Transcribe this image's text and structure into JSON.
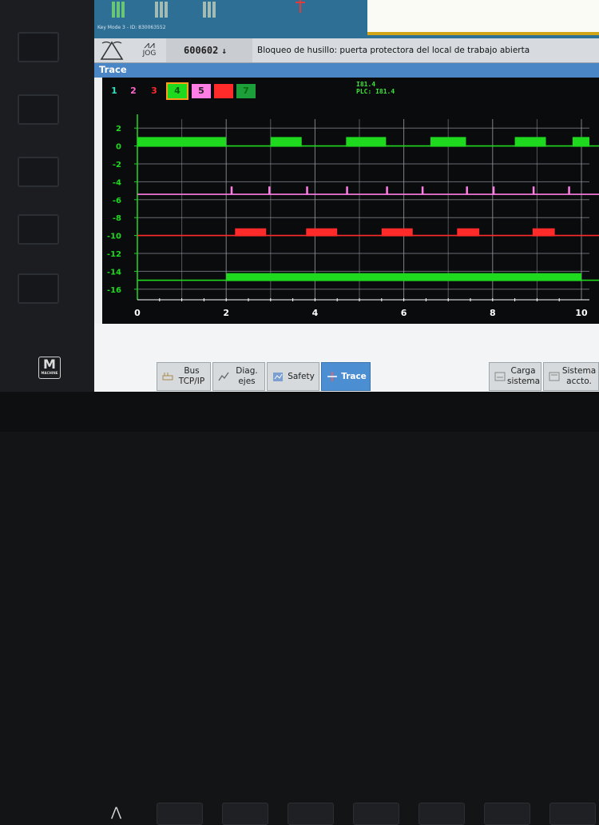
{
  "header": {
    "key_mode": "Key Mode 3 - ID: 830063552",
    "mode": "JOG",
    "alarm_number": "600602",
    "alarm_arrow": "↓",
    "alarm_message": "Bloqueo de husillo: puerta protectora del local de trabajo abierta"
  },
  "window": {
    "title": "Trace"
  },
  "legend": [
    {
      "label": "1",
      "color": "#33e0c0"
    },
    {
      "label": "2",
      "color": "#ff66cc"
    },
    {
      "label": "3",
      "color": "#ff2a2a"
    },
    {
      "label": "4",
      "color": "#1fd91f",
      "selected": true
    },
    {
      "label": "5",
      "color": "#ff7ee6"
    },
    {
      "label": "6",
      "color": "#ff2a2a"
    },
    {
      "label": "7",
      "color": "#1c9e3a"
    }
  ],
  "signal_label": {
    "line1": "I81.4",
    "line2": "PLC: I81.4"
  },
  "chart_data": {
    "type": "line",
    "x_ticks": [
      "0",
      "2",
      "4",
      "6",
      "8",
      "10"
    ],
    "y_ticks": [
      "2",
      "0",
      "-2",
      "-4",
      "-6",
      "-8",
      "-10",
      "-12",
      "-14",
      "-16"
    ],
    "xlim": [
      0,
      10
    ],
    "ylim": [
      -17,
      3
    ],
    "grid": true,
    "series": [
      {
        "color": "#1fd91f",
        "low": 0,
        "high": 1,
        "pulses": [
          [
            0,
            2.0
          ],
          [
            3.0,
            3.7
          ],
          [
            4.7,
            5.6
          ],
          [
            6.6,
            7.4
          ],
          [
            8.5,
            9.2
          ],
          [
            9.8,
            10.5
          ]
        ]
      },
      {
        "color": "#ff7ee6",
        "low": -5.4,
        "high": -4.7,
        "pulses": [
          [
            2.1,
            2.15
          ],
          [
            2.95,
            3.0
          ],
          [
            3.8,
            3.85
          ],
          [
            4.7,
            4.75
          ],
          [
            5.6,
            5.65
          ],
          [
            6.4,
            6.45
          ],
          [
            7.4,
            7.45
          ],
          [
            8.0,
            8.05
          ],
          [
            8.9,
            8.95
          ],
          [
            9.7,
            9.75
          ]
        ]
      },
      {
        "color": "#ff2a2a",
        "low": -10.0,
        "high": -9.2,
        "pulses": [
          [
            2.2,
            2.9
          ],
          [
            3.8,
            4.5
          ],
          [
            5.5,
            6.2
          ],
          [
            7.2,
            7.7
          ],
          [
            8.9,
            9.4
          ]
        ]
      },
      {
        "color": "#1fd91f",
        "low": -15.0,
        "high": -14.2,
        "pulses": [
          [
            2.0,
            10.0
          ]
        ]
      }
    ]
  },
  "softkeys": [
    {
      "id": "bus",
      "line1": "Bus",
      "line2": "TCP/IP",
      "icon": "bus-icon",
      "active": false
    },
    {
      "id": "diag",
      "line1": "Diag.",
      "line2": "ejes",
      "icon": "diagnostics-icon",
      "active": false
    },
    {
      "id": "safety",
      "line1": "Safety",
      "line2": "",
      "icon": "safety-icon",
      "active": false
    },
    {
      "id": "trace",
      "line1": "Trace",
      "line2": "",
      "icon": "trace-icon",
      "active": true
    },
    {
      "id": "carga",
      "line1": "Carga",
      "line2": "sistema",
      "icon": "load-icon",
      "active": false
    },
    {
      "id": "sistema",
      "line1": "Sistema",
      "line2": "accto.",
      "icon": "system-icon",
      "active": false
    }
  ],
  "machine_logo": "M"
}
